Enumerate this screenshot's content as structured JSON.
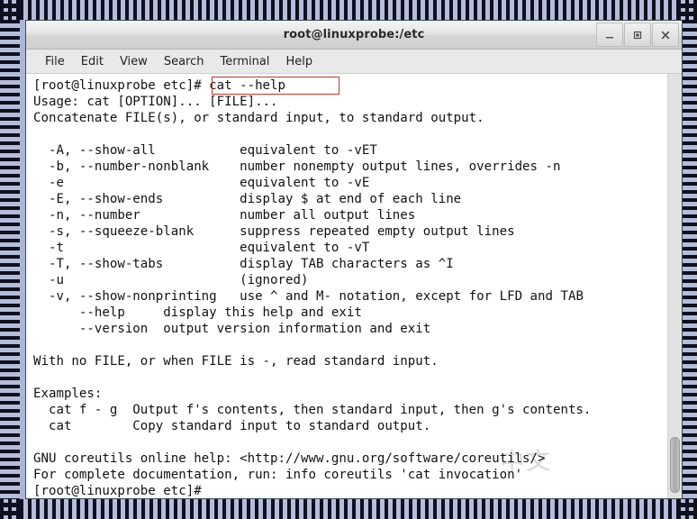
{
  "window": {
    "title": "root@linuxprobe:/etc",
    "controls": [
      {
        "name": "minimize",
        "label": "–"
      },
      {
        "name": "maximize",
        "label": "□"
      },
      {
        "name": "close",
        "label": "✕"
      }
    ]
  },
  "menubar": {
    "items": [
      {
        "label": "File"
      },
      {
        "label": "Edit"
      },
      {
        "label": "View"
      },
      {
        "label": "Search"
      },
      {
        "label": "Terminal"
      },
      {
        "label": "Help"
      }
    ]
  },
  "terminal": {
    "prompt": "[root@linuxprobe etc]#",
    "command": "cat --help",
    "highlight_color": "#c0392b",
    "watermark": "中文",
    "lines": [
      "[root@linuxprobe etc]# cat --help",
      "Usage: cat [OPTION]... [FILE]...",
      "Concatenate FILE(s), or standard input, to standard output.",
      "",
      "  -A, --show-all           equivalent to -vET",
      "  -b, --number-nonblank    number nonempty output lines, overrides -n",
      "  -e                       equivalent to -vE",
      "  -E, --show-ends          display $ at end of each line",
      "  -n, --number             number all output lines",
      "  -s, --squeeze-blank      suppress repeated empty output lines",
      "  -t                       equivalent to -vT",
      "  -T, --show-tabs          display TAB characters as ^I",
      "  -u                       (ignored)",
      "  -v, --show-nonprinting   use ^ and M- notation, except for LFD and TAB",
      "      --help     display this help and exit",
      "      --version  output version information and exit",
      "",
      "With no FILE, or when FILE is -, read standard input.",
      "",
      "Examples:",
      "  cat f - g  Output f's contents, then standard input, then g's contents.",
      "  cat        Copy standard input to standard output.",
      "",
      "GNU coreutils online help: <http://www.gnu.org/software/coreutils/>",
      "For complete documentation, run: info coreutils 'cat invocation'",
      "[root@linuxprobe etc]#"
    ]
  },
  "scrollbar": {
    "position": "bottom"
  }
}
